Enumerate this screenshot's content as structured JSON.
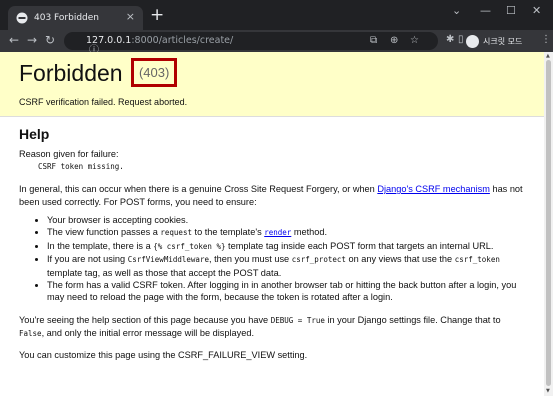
{
  "browser": {
    "tab_title": "403 Forbidden",
    "tab_close": "×",
    "new_tab": "+",
    "url_host": "127.0.0.1",
    "url_rest": ":8000/articles/create/",
    "profile_label": "시크릿 모드",
    "icons": [
      "favicon-forbidden-icon",
      "back-icon",
      "forward-icon",
      "reload-icon",
      "info-icon",
      "translate-icon",
      "zoom-icon",
      "star-icon",
      "extensions-icon",
      "sidebar-icon",
      "profile-icon",
      "menu-icon"
    ]
  },
  "summary": {
    "title": "Forbidden",
    "code": "(403)",
    "message": "CSRF verification failed. Request aborted."
  },
  "help": {
    "heading": "Help",
    "reason_label": "Reason given for failure:",
    "reason": "CSRF token missing.",
    "general_pre": "In general, this can occur when there is a genuine Cross Site Request Forgery, or when ",
    "general_link": "Django's CSRF mechanism",
    "general_post": " has not been used correctly. For POST forms, you need to ensure:",
    "bullet1": "Your browser is accepting cookies.",
    "bullet2_pre": "The view function passes a ",
    "bullet2_code": "request",
    "bullet2_mid": " to the template's ",
    "bullet2_link": "render",
    "bullet2_post": " method.",
    "bullet3_pre": "In the template, there is a ",
    "bullet3_code": "{% csrf_token %}",
    "bullet3_post": " template tag inside each POST form that targets an internal URL.",
    "bullet4_pre": "If you are not using ",
    "bullet4_code1": "CsrfViewMiddleware",
    "bullet4_mid": ", then you must use ",
    "bullet4_code2": "csrf_protect",
    "bullet4_mid2": " on any views that use the ",
    "bullet4_code3": "csrf_token",
    "bullet4_post": " template tag, as well as those that accept the POST data.",
    "bullet5": "The form has a valid CSRF token. After logging in in another browser tab or hitting the back button after a login, you may need to reload the page with the form, because the token is rotated after a login.",
    "debug_pre": "You're seeing the help section of this page because you have ",
    "debug_code1": "DEBUG = True",
    "debug_mid": " in your Django settings file. Change that to ",
    "debug_code2": "False",
    "debug_post": ", and only the initial error message will be displayed.",
    "customize": "You can customize this page using the CSRF_FAILURE_VIEW setting."
  }
}
